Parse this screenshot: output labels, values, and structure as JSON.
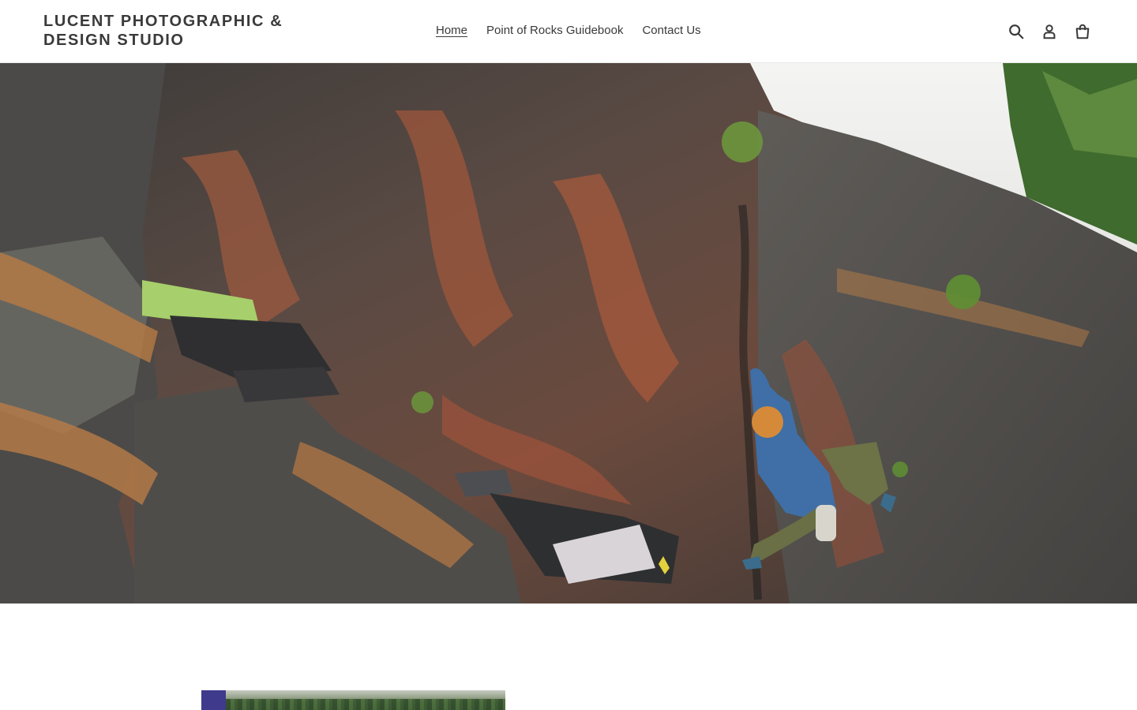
{
  "header": {
    "logo_text": "LUCENT PHOTOGRAPHIC & DESIGN STUDIO",
    "nav": [
      {
        "label": "Home",
        "active": true
      },
      {
        "label": "Point of Rocks Guidebook",
        "active": false
      },
      {
        "label": "Contact Us",
        "active": false
      }
    ],
    "icons": [
      "search-icon",
      "account-icon",
      "cart-icon"
    ]
  },
  "hero": {
    "image": "boulder-climber-photo"
  },
  "featured": {
    "image": "forest-landscape-thumbnail",
    "accent_color": "#3f3a8c"
  },
  "colors": {
    "text": "#3a3a3a",
    "background": "#ffffff",
    "border": "#e8e8e8"
  }
}
